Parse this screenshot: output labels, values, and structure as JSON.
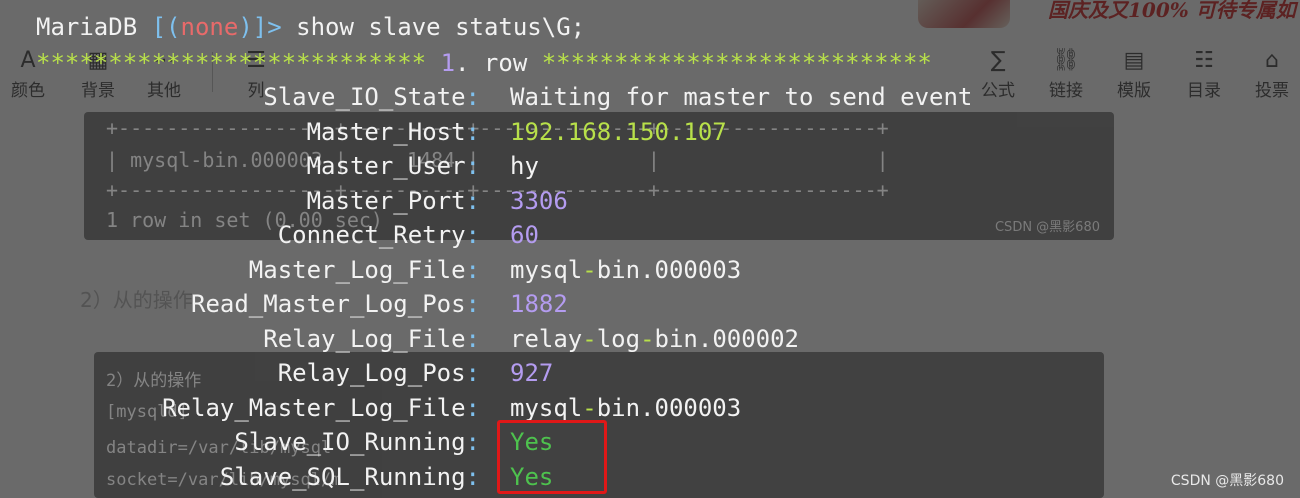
{
  "background": {
    "toolbar": [
      {
        "label": "颜色",
        "icon": "A"
      },
      {
        "label": "背景",
        "icon": "▦"
      },
      {
        "label": "其他",
        "icon": "⋯"
      },
      {
        "label": "列",
        "icon": "☰"
      },
      {
        "label": "公式",
        "icon": "∑"
      },
      {
        "label": "链接",
        "icon": "⛓"
      },
      {
        "label": "模版",
        "icon": "▤"
      },
      {
        "label": "目录",
        "icon": "☷"
      },
      {
        "label": "投票",
        "icon": "⌂"
      }
    ],
    "promo_text": "国庆及又100% 可待专属如",
    "code_block_1_lines": [
      "+------------------+----------+--------------+------------------+",
      "| mysql-bin.000003 |     1484 |              |                  |",
      "+------------------+----------+--------------+------------------+",
      "1 row in set (0.00 sec)"
    ],
    "code_block_1_watermark": "CSDN @黑影680",
    "heading": "2）从的操作",
    "code_block_2_lines": [
      "2）从的操作",
      "[mysqld]",
      "datadir=/var/lib/mysql",
      "socket=/var/lib/mysql/m"
    ]
  },
  "terminal": {
    "prompt_db": "MariaDB",
    "prompt_open": " [(",
    "prompt_none": "none",
    "prompt_close": ")]>",
    "command": " show slave status\\G;",
    "row_stars_left": "*************************** ",
    "row_num": "1",
    "row_text": ". row ",
    "row_stars_right": "***************************",
    "fields": {
      "slave_io_state_key": "Slave_IO_State",
      "slave_io_state_val": "Waiting for master to send event",
      "master_host_key": "Master_Host",
      "master_host_val": "192.168.150.107",
      "master_user_key": "Master_User",
      "master_user_val": "hy",
      "master_port_key": "Master_Port",
      "master_port_val": "3306",
      "connect_retry_key": "Connect_Retry",
      "connect_retry_val": "60",
      "master_log_file_key": "Master_Log_File",
      "master_log_file_val_a": "mysql",
      "master_log_file_val_b": "bin.000003",
      "read_master_log_pos_key": "Read_Master_Log_Pos",
      "read_master_log_pos_val": "1882",
      "relay_log_file_key": "Relay_Log_File",
      "relay_log_file_val_a": "relay",
      "relay_log_file_val_b": "log",
      "relay_log_file_val_c": "bin.000002",
      "relay_log_pos_key": "Relay_Log_Pos",
      "relay_log_pos_val": "927",
      "relay_master_log_file_key": "Relay_Master_Log_File",
      "relay_master_log_file_val_a": "mysql",
      "relay_master_log_file_val_b": "bin.000003",
      "slave_io_running_key": "Slave_IO_Running",
      "slave_io_running_val": "Yes",
      "slave_sql_running_key": "Slave_SQL_Running",
      "slave_sql_running_val": "Yes"
    },
    "colon": ":",
    "dash": "-"
  },
  "watermark": "CSDN @黑影680",
  "colors": {
    "highlight_box": "#e01818",
    "number": "#b49cf0",
    "string_green": "#b8e04a",
    "yes_green": "#4ec24e"
  }
}
